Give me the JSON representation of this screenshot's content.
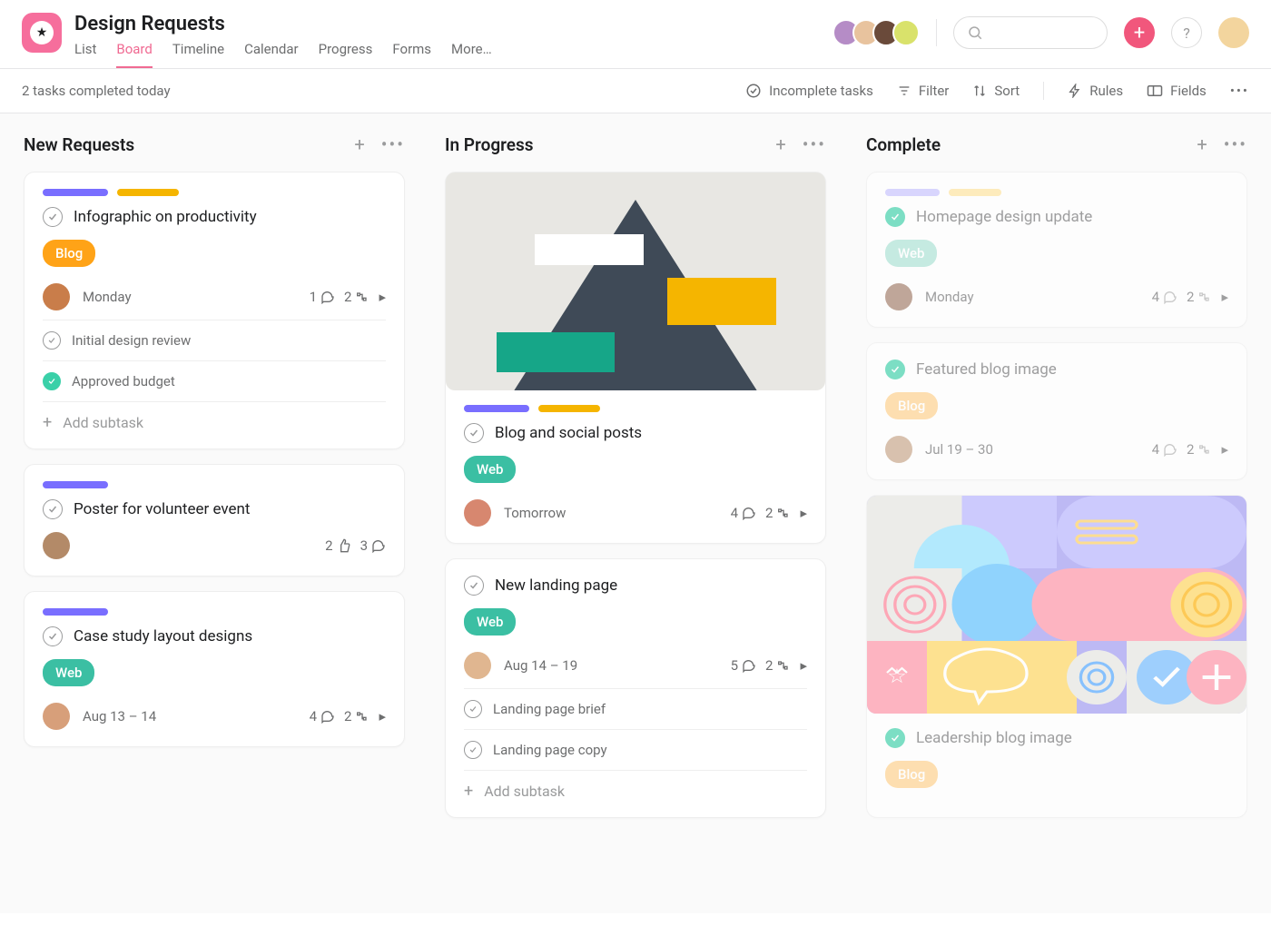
{
  "header": {
    "title": "Design Requests",
    "tabs": [
      "List",
      "Board",
      "Timeline",
      "Calendar",
      "Progress",
      "Forms",
      "More…"
    ],
    "active_tab": 1,
    "search_placeholder": ""
  },
  "toolbar": {
    "status": "2 tasks completed today",
    "incomplete": "Incomplete tasks",
    "filter": "Filter",
    "sort": "Sort",
    "rules": "Rules",
    "fields": "Fields"
  },
  "columns": [
    {
      "title": "New Requests",
      "cards": [
        {
          "pills": [
            "purple",
            "yellow"
          ],
          "title": "Infographic on productivity",
          "tag": {
            "label": "Blog",
            "style": "orange"
          },
          "due": "Monday",
          "stats": {
            "comments": 1,
            "subtasks": 2,
            "likes": null
          },
          "subtasks": [
            {
              "done": false,
              "title": "Initial design review"
            },
            {
              "done": true,
              "title": "Approved budget"
            }
          ],
          "add_subtask": "Add subtask"
        },
        {
          "pills": [
            "purple"
          ],
          "title": "Poster for volunteer event",
          "stats": {
            "likes": 2,
            "comments": 3
          }
        },
        {
          "pills": [
            "purple"
          ],
          "title": "Case study layout designs",
          "tag": {
            "label": "Web",
            "style": "teal"
          },
          "due": "Aug 13 – 14",
          "stats": {
            "comments": 4,
            "subtasks": 2
          }
        }
      ]
    },
    {
      "title": "In Progress",
      "cards": [
        {
          "cover": "mountain",
          "pills": [
            "purple",
            "yellow"
          ],
          "title": "Blog and social posts",
          "tag": {
            "label": "Web",
            "style": "teal"
          },
          "due": "Tomorrow",
          "stats": {
            "comments": 4,
            "subtasks": 2
          }
        },
        {
          "title": "New landing page",
          "tag": {
            "label": "Web",
            "style": "teal"
          },
          "due": "Aug 14 – 19",
          "stats": {
            "comments": 5,
            "subtasks": 2
          },
          "subtasks": [
            {
              "done": false,
              "title": "Landing page brief"
            },
            {
              "done": false,
              "title": "Landing page copy"
            }
          ],
          "add_subtask": "Add subtask"
        }
      ]
    },
    {
      "title": "Complete",
      "faded": true,
      "cards": [
        {
          "pills": [
            "faded-purple",
            "faded-yellow"
          ],
          "done": true,
          "title": "Homepage design update",
          "tag": {
            "label": "Web",
            "style": "faded-teal"
          },
          "due": "Monday",
          "stats": {
            "comments": 4,
            "subtasks": 2
          }
        },
        {
          "done": true,
          "title": "Featured blog image",
          "tag": {
            "label": "Blog",
            "style": "faded-orange"
          },
          "due": "Jul 19 – 30",
          "stats": {
            "comments": 4,
            "subtasks": 2
          }
        },
        {
          "cover": "pattern",
          "done": true,
          "title": "Leadership blog image",
          "tag": {
            "label": "Blog",
            "style": "faded-orange"
          }
        }
      ]
    }
  ]
}
